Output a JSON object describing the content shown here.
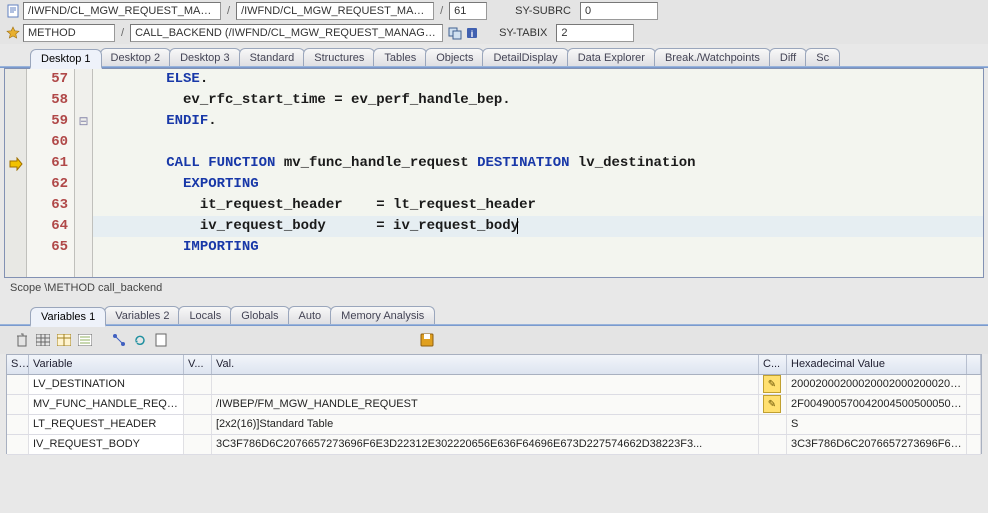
{
  "nav1": {
    "icon": "doc",
    "field1": "/IWFND/CL_MGW_REQUEST_MANAGER...",
    "field2": "/IWFND/CL_MGW_REQUEST_MANAGER...",
    "lineNo": "61",
    "subrc_label": "SY-SUBRC",
    "subrc_val": "0"
  },
  "nav2": {
    "icon": "star",
    "field1": "METHOD",
    "field2": "CALL_BACKEND (/IWFND/CL_MGW_REQUEST_MANAGE...",
    "tabix_label": "SY-TABIX",
    "tabix_val": "2"
  },
  "tabs": {
    "items": [
      {
        "label": "Desktop 1",
        "active": true
      },
      {
        "label": "Desktop 2"
      },
      {
        "label": "Desktop 3"
      },
      {
        "label": "Standard"
      },
      {
        "label": "Structures"
      },
      {
        "label": "Tables"
      },
      {
        "label": "Objects"
      },
      {
        "label": "DetailDisplay"
      },
      {
        "label": "Data Explorer"
      },
      {
        "label": "Break./Watchpoints"
      },
      {
        "label": "Diff"
      },
      {
        "label": "Sc"
      }
    ]
  },
  "code": {
    "lines": [
      {
        "n": 57,
        "indent": "        ",
        "tokens": [
          {
            "t": "ELSE",
            "kw": true
          },
          {
            "t": "."
          }
        ]
      },
      {
        "n": 58,
        "indent": "          ",
        "tokens": [
          {
            "t": "ev_rfc_start_time = ev_perf_handle_bep."
          }
        ]
      },
      {
        "n": 59,
        "indent": "        ",
        "tokens": [
          {
            "t": "ENDIF",
            "kw": true
          },
          {
            "t": "."
          }
        ]
      },
      {
        "n": 60,
        "indent": "",
        "tokens": []
      },
      {
        "n": 61,
        "indent": "        ",
        "arrow": true,
        "tokens": [
          {
            "t": "CALL FUNCTION",
            "kw": true
          },
          {
            "t": " mv_func_handle_request "
          },
          {
            "t": "DESTINATION",
            "kw": true
          },
          {
            "t": " lv_destination"
          }
        ]
      },
      {
        "n": 62,
        "indent": "          ",
        "tokens": [
          {
            "t": "EXPORTING",
            "kw": true
          }
        ]
      },
      {
        "n": 63,
        "indent": "            ",
        "tokens": [
          {
            "t": "it_request_header    = lt_request_header"
          }
        ]
      },
      {
        "n": 64,
        "indent": "            ",
        "hl": true,
        "caret": true,
        "tokens": [
          {
            "t": "iv_request_body      = iv_request_body"
          }
        ]
      },
      {
        "n": 65,
        "indent": "          ",
        "tokens": [
          {
            "t": "IMPORTING",
            "kw": true
          }
        ]
      }
    ],
    "fold": {
      "0": "",
      "1": "",
      "2": "⊟",
      "3": "",
      "4": "",
      "5": "",
      "6": "",
      "7": "",
      "8": ""
    }
  },
  "scope": "Scope \\METHOD call_backend",
  "var_tabs": {
    "items": [
      {
        "label": "Variables 1",
        "active": true
      },
      {
        "label": "Variables 2"
      },
      {
        "label": "Locals"
      },
      {
        "label": "Globals"
      },
      {
        "label": "Auto"
      },
      {
        "label": "Memory Analysis"
      }
    ]
  },
  "table": {
    "headers": {
      "s": "S...",
      "variable": "Variable",
      "vt": "V...",
      "val": "Val.",
      "ch": "C...",
      "hex": "Hexadecimal Value"
    },
    "rows": [
      {
        "name": "LV_DESTINATION",
        "val": "",
        "pencil": true,
        "hex": "2000200020002000200020002000..."
      },
      {
        "name": "MV_FUNC_HANDLE_REQU...",
        "val": "/IWBEP/FM_MGW_HANDLE_REQUEST",
        "pencil": true,
        "hex": "2F004900570042004500500050000..."
      },
      {
        "name": "LT_REQUEST_HEADER",
        "val": "[2x2(16)]Standard Table",
        "pencil": false,
        "hex": "S"
      },
      {
        "name": "IV_REQUEST_BODY",
        "val": "3C3F786D6C2076657273696F6E3D22312E302220656E636F64696E673D227574662D38223F3...",
        "pencil": false,
        "hex": "3C3F786D6C2076657273696F6E..."
      }
    ]
  }
}
